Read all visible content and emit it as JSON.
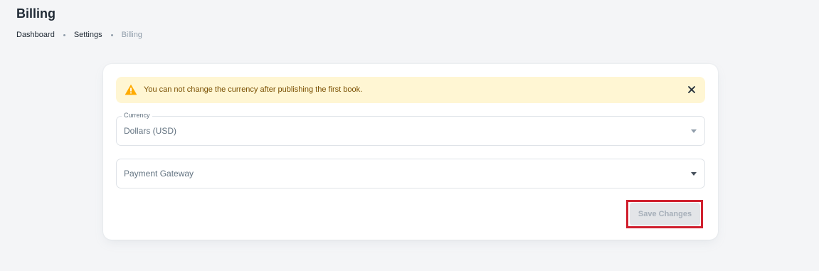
{
  "page": {
    "title": "Billing"
  },
  "breadcrumb": {
    "items": [
      "Dashboard",
      "Settings",
      "Billing"
    ]
  },
  "alert": {
    "message": "You can not change the currency after publishing the first book.",
    "icon": "warning-icon",
    "close_icon": "close-icon"
  },
  "form": {
    "currency": {
      "label": "Currency",
      "value": "Dollars (USD)"
    },
    "payment_gateway": {
      "placeholder": "Payment Gateway"
    },
    "save_label": "Save Changes"
  },
  "colors": {
    "background": "#f4f5f7",
    "alert_background": "#fff6d3",
    "alert_icon": "#ffab00",
    "highlight_outline": "#d0202e",
    "disabled_button": "#e3e5e8"
  }
}
